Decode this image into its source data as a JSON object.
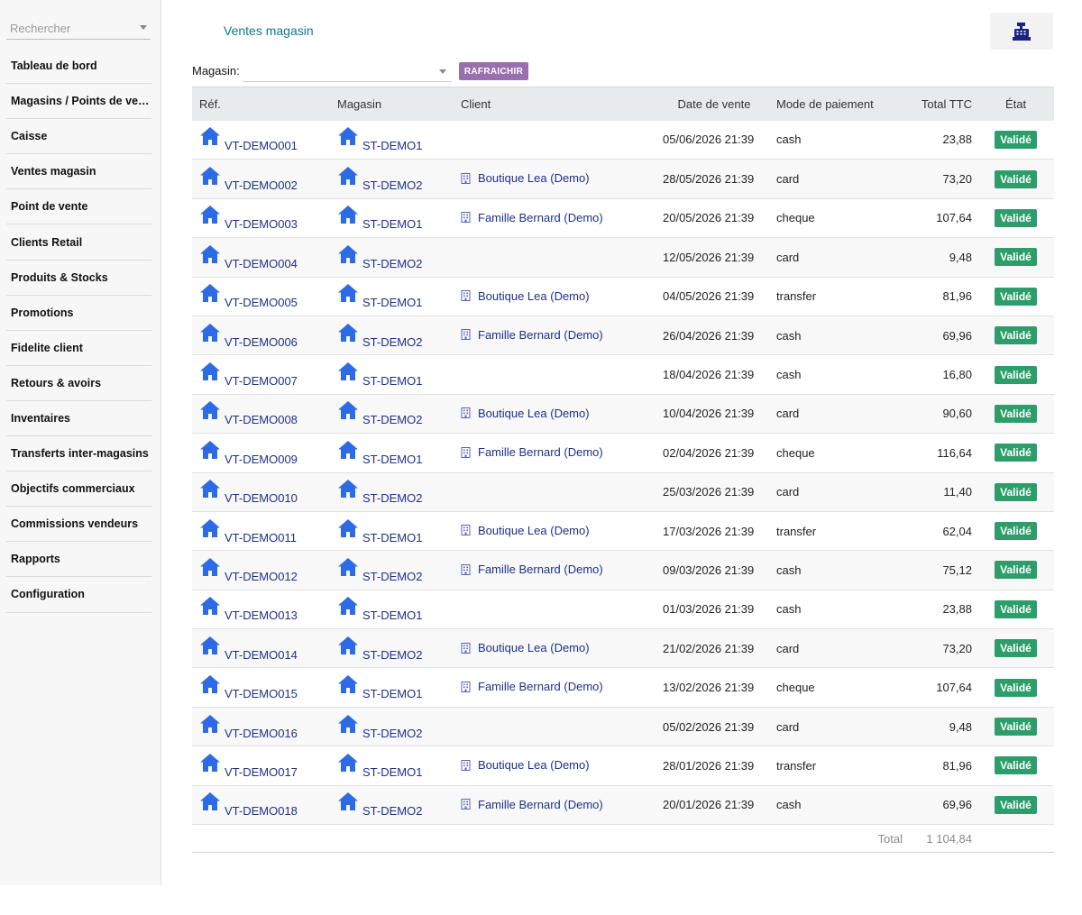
{
  "sidebar": {
    "search_placeholder": "Rechercher",
    "items": [
      {
        "label": "Tableau de bord"
      },
      {
        "label": "Magasins / Points de vente"
      },
      {
        "label": "Caisse"
      },
      {
        "label": "Ventes magasin"
      },
      {
        "label": "Point de vente"
      },
      {
        "label": "Clients Retail"
      },
      {
        "label": "Produits & Stocks"
      },
      {
        "label": "Promotions"
      },
      {
        "label": "Fidelite client"
      },
      {
        "label": "Retours & avoirs"
      },
      {
        "label": "Inventaires"
      },
      {
        "label": "Transferts inter-magasins"
      },
      {
        "label": "Objectifs commerciaux"
      },
      {
        "label": "Commissions vendeurs"
      },
      {
        "label": "Rapports"
      },
      {
        "label": "Configuration"
      }
    ]
  },
  "header": {
    "title": "Ventes magasin",
    "pos_icon": "cash-register-icon"
  },
  "filter": {
    "label": "Magasin:",
    "value": "",
    "refresh_label": "RAFRAICHIR"
  },
  "table": {
    "columns": [
      "Réf.",
      "Magasin",
      "Client",
      "Date de vente",
      "Mode de paiement",
      "Total TTC",
      "État"
    ],
    "rows": [
      {
        "ref": "VT-DEMO001",
        "store": "ST-DEMO1",
        "client": "",
        "date": "05/06/2026 21:39",
        "payment": "cash",
        "total": "23,88",
        "state": "Validé"
      },
      {
        "ref": "VT-DEMO002",
        "store": "ST-DEMO2",
        "client": "Boutique Lea (Demo)",
        "date": "28/05/2026 21:39",
        "payment": "card",
        "total": "73,20",
        "state": "Validé"
      },
      {
        "ref": "VT-DEMO003",
        "store": "ST-DEMO1",
        "client": "Famille Bernard (Demo)",
        "date": "20/05/2026 21:39",
        "payment": "cheque",
        "total": "107,64",
        "state": "Validé"
      },
      {
        "ref": "VT-DEMO004",
        "store": "ST-DEMO2",
        "client": "",
        "date": "12/05/2026 21:39",
        "payment": "card",
        "total": "9,48",
        "state": "Validé"
      },
      {
        "ref": "VT-DEMO005",
        "store": "ST-DEMO1",
        "client": "Boutique Lea (Demo)",
        "date": "04/05/2026 21:39",
        "payment": "transfer",
        "total": "81,96",
        "state": "Validé"
      },
      {
        "ref": "VT-DEMO006",
        "store": "ST-DEMO2",
        "client": "Famille Bernard (Demo)",
        "date": "26/04/2026 21:39",
        "payment": "cash",
        "total": "69,96",
        "state": "Validé"
      },
      {
        "ref": "VT-DEMO007",
        "store": "ST-DEMO1",
        "client": "",
        "date": "18/04/2026 21:39",
        "payment": "cash",
        "total": "16,80",
        "state": "Validé"
      },
      {
        "ref": "VT-DEMO008",
        "store": "ST-DEMO2",
        "client": "Boutique Lea (Demo)",
        "date": "10/04/2026 21:39",
        "payment": "card",
        "total": "90,60",
        "state": "Validé"
      },
      {
        "ref": "VT-DEMO009",
        "store": "ST-DEMO1",
        "client": "Famille Bernard (Demo)",
        "date": "02/04/2026 21:39",
        "payment": "cheque",
        "total": "116,64",
        "state": "Validé"
      },
      {
        "ref": "VT-DEMO010",
        "store": "ST-DEMO2",
        "client": "",
        "date": "25/03/2026 21:39",
        "payment": "card",
        "total": "11,40",
        "state": "Validé"
      },
      {
        "ref": "VT-DEMO011",
        "store": "ST-DEMO1",
        "client": "Boutique Lea (Demo)",
        "date": "17/03/2026 21:39",
        "payment": "transfer",
        "total": "62,04",
        "state": "Validé"
      },
      {
        "ref": "VT-DEMO012",
        "store": "ST-DEMO2",
        "client": "Famille Bernard (Demo)",
        "date": "09/03/2026 21:39",
        "payment": "cash",
        "total": "75,12",
        "state": "Validé"
      },
      {
        "ref": "VT-DEMO013",
        "store": "ST-DEMO1",
        "client": "",
        "date": "01/03/2026 21:39",
        "payment": "cash",
        "total": "23,88",
        "state": "Validé"
      },
      {
        "ref": "VT-DEMO014",
        "store": "ST-DEMO2",
        "client": "Boutique Lea (Demo)",
        "date": "21/02/2026 21:39",
        "payment": "card",
        "total": "73,20",
        "state": "Validé"
      },
      {
        "ref": "VT-DEMO015",
        "store": "ST-DEMO1",
        "client": "Famille Bernard (Demo)",
        "date": "13/02/2026 21:39",
        "payment": "cheque",
        "total": "107,64",
        "state": "Validé"
      },
      {
        "ref": "VT-DEMO016",
        "store": "ST-DEMO2",
        "client": "",
        "date": "05/02/2026 21:39",
        "payment": "card",
        "total": "9,48",
        "state": "Validé"
      },
      {
        "ref": "VT-DEMO017",
        "store": "ST-DEMO1",
        "client": "Boutique Lea (Demo)",
        "date": "28/01/2026 21:39",
        "payment": "transfer",
        "total": "81,96",
        "state": "Validé"
      },
      {
        "ref": "VT-DEMO018",
        "store": "ST-DEMO2",
        "client": "Famille Bernard (Demo)",
        "date": "20/01/2026 21:39",
        "payment": "cash",
        "total": "69,96",
        "state": "Validé"
      }
    ],
    "footer": {
      "label": "Total",
      "value": "1 104,84"
    }
  },
  "colors": {
    "accent_title": "#0e7a86",
    "link": "#1f2f8a",
    "home_icon": "#2d6be6",
    "badge": "#2d9d6c",
    "refresh_button": "#9a6fae"
  }
}
